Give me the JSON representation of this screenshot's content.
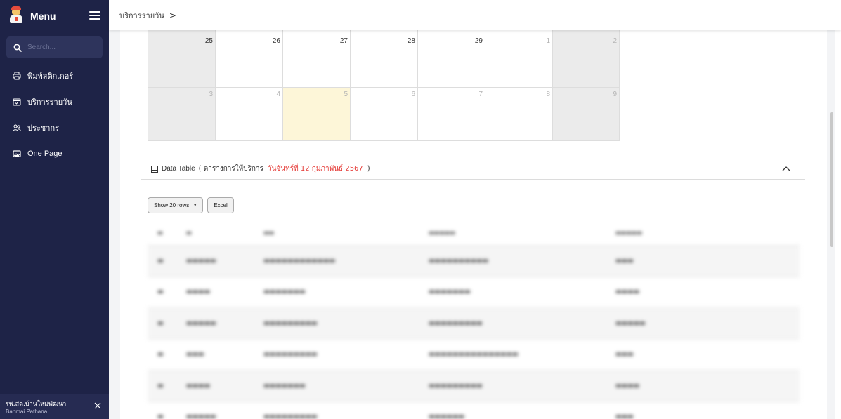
{
  "sidebar": {
    "title": "Menu",
    "search_placeholder": "Search...",
    "items": [
      {
        "label": "พิมพ์สติกเกอร์",
        "icon": "printer-icon"
      },
      {
        "label": "บริการรายวัน",
        "icon": "calendar-icon"
      },
      {
        "label": "ประชากร",
        "icon": "users-icon"
      },
      {
        "label": "One Page",
        "icon": "image-icon"
      }
    ],
    "footer": {
      "name_th": "รพ.สต.บ้านใหม่พัฒนา",
      "name_en": "Banmai Pathana"
    }
  },
  "breadcrumb": {
    "current": "บริการรายวัน",
    "separator": ">"
  },
  "calendar": {
    "rows": [
      [
        {
          "day": "25",
          "weekend": true,
          "other": false
        },
        {
          "day": "26",
          "weekend": false,
          "other": false
        },
        {
          "day": "27",
          "weekend": false,
          "other": false
        },
        {
          "day": "28",
          "weekend": false,
          "other": false
        },
        {
          "day": "29",
          "weekend": false,
          "other": false
        },
        {
          "day": "1",
          "weekend": false,
          "other": true
        },
        {
          "day": "2",
          "weekend": true,
          "other": true
        }
      ],
      [
        {
          "day": "3",
          "weekend": true,
          "other": true
        },
        {
          "day": "4",
          "weekend": false,
          "other": true
        },
        {
          "day": "5",
          "weekend": false,
          "other": true,
          "today": true
        },
        {
          "day": "6",
          "weekend": false,
          "other": true
        },
        {
          "day": "7",
          "weekend": false,
          "other": true
        },
        {
          "day": "8",
          "weekend": false,
          "other": true
        },
        {
          "day": "9",
          "weekend": true,
          "other": true
        }
      ]
    ]
  },
  "data_table": {
    "label": "Data Table",
    "title_open": "( ตารางการให้บริการ",
    "date_text": "วันจันทร์ที่ 12 กุมภาพันธ์ 2567",
    "title_close": ")",
    "show_rows_label": "Show 20 rows",
    "excel_label": "Excel"
  },
  "colors": {
    "sidebar_bg": "#1e2347",
    "accent_red": "#e53935",
    "today_bg": "#fdf6d8",
    "weekend_bg": "#ebebeb"
  }
}
